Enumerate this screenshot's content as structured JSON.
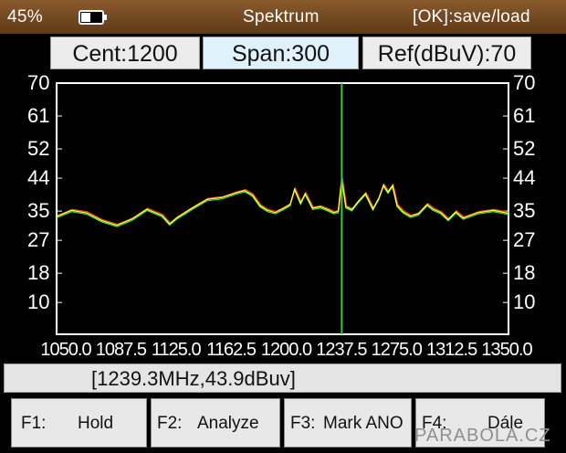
{
  "header": {
    "battery_percent": "45%",
    "battery_level": 0.45,
    "title": "Spektrum",
    "hint": "[OK]:save/load"
  },
  "params": {
    "center": "Cent:1200",
    "span": "Span:300",
    "ref": "Ref(dBuV):70"
  },
  "readout": "[1239.3MHz,43.9dBuv]",
  "function_keys": [
    {
      "key": "F1:",
      "action": "Hold"
    },
    {
      "key": "F2:",
      "action": "Analyze"
    },
    {
      "key": "F3:",
      "action": "Mark ANO"
    },
    {
      "key": "F4:",
      "action": "Dále"
    }
  ],
  "watermark": "PARABOLA.CZ",
  "colors": {
    "header_bg": "#7a4e24",
    "plot_bg": "#000000",
    "grid": "#ffffff",
    "trace_primary": "#ffff40",
    "trace_secondary": "#ff4040",
    "trace_tertiary": "#40ff40",
    "marker": "#2ecc2e"
  },
  "chart_data": {
    "type": "line",
    "y_ticks": [
      "70",
      "61",
      "52",
      "44",
      "35",
      "27",
      "18",
      "10"
    ],
    "x_ticks": [
      "1050.0",
      "1087.5",
      "1125.0",
      "1162.5",
      "1200.0",
      "1237.5",
      "1275.0",
      "1312.5",
      "1350.0"
    ],
    "xlim": [
      1050,
      1350
    ],
    "ylim": [
      1.3,
      70
    ],
    "marker_x": 1239.3,
    "marker_y": 43.9,
    "x": [
      1050,
      1060,
      1070,
      1080,
      1090,
      1100,
      1110,
      1120,
      1125,
      1130,
      1140,
      1150,
      1160,
      1170,
      1175,
      1180,
      1185,
      1190,
      1195,
      1200,
      1205,
      1208,
      1212,
      1215,
      1220,
      1225,
      1230,
      1234,
      1237,
      1239.3,
      1242,
      1246,
      1250,
      1255,
      1260,
      1264,
      1267,
      1270,
      1273,
      1276,
      1280,
      1285,
      1290,
      1296,
      1300,
      1305,
      1310,
      1315,
      1320,
      1330,
      1340,
      1350
    ],
    "y": [
      33.5,
      35.2,
      34.5,
      32.4,
      31.1,
      32.8,
      35.5,
      33.8,
      31.5,
      33.2,
      35.8,
      38.2,
      38.7,
      40.1,
      40.6,
      39.4,
      36.5,
      35.2,
      34.6,
      35.6,
      36.8,
      41.0,
      37.2,
      39.8,
      35.8,
      36.2,
      35.4,
      34.6,
      34.9,
      43.9,
      36.2,
      35.4,
      37.5,
      39.8,
      35.6,
      38.6,
      42.1,
      40.2,
      42.0,
      36.6,
      34.8,
      33.6,
      34.2,
      36.8,
      35.5,
      34.6,
      32.7,
      34.8,
      33.1,
      34.6,
      35.2,
      34.4
    ]
  }
}
